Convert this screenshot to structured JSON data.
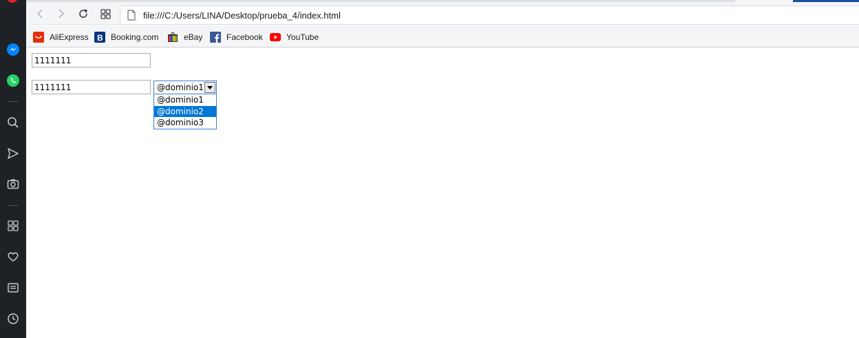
{
  "browser": {
    "url": "file:///C:/Users/LINA/Desktop/prueba_4/index.html"
  },
  "bookmarks": [
    {
      "label": "AliExpress",
      "icon": "aliexpress-icon",
      "color": "#e62e04"
    },
    {
      "label": "Booking.com",
      "icon": "booking-icon",
      "color": "#003580"
    },
    {
      "label": "eBay",
      "icon": "ebay-icon",
      "color": "#f5af02"
    },
    {
      "label": "Facebook",
      "icon": "facebook-icon",
      "color": "#3b5998"
    },
    {
      "label": "YouTube",
      "icon": "youtube-icon",
      "color": "#ff0000"
    }
  ],
  "sidebar": {
    "icons": [
      "messenger-icon",
      "whatsapp-icon",
      "search-icon",
      "send-icon",
      "camera-icon",
      "apps-grid-icon",
      "heart-icon",
      "news-icon",
      "history-icon"
    ]
  },
  "page": {
    "input1_value": "1111111",
    "input2_value": "1111111",
    "select": {
      "selected": "@dominio1",
      "options": [
        "@dominio1",
        "@dominio2",
        "@dominio3"
      ],
      "highlighted": "@dominio2"
    }
  },
  "colors": {
    "highlight": "#0078d7",
    "select_border": "#3a7bd5"
  }
}
